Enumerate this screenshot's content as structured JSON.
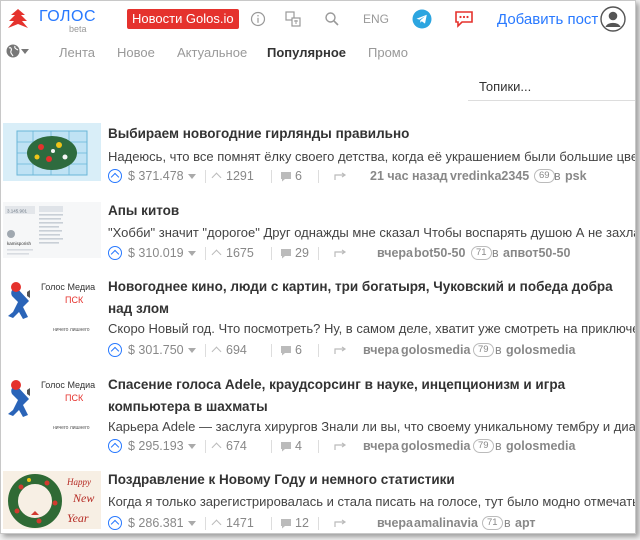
{
  "header": {
    "brand": "ГОЛОС",
    "beta": "beta",
    "news_button": "Новости Golos.io",
    "lang": "ENG",
    "add_post": "Добавить пост"
  },
  "nav": {
    "tabs": [
      {
        "label": "Лента",
        "active": false
      },
      {
        "label": "Новое",
        "active": false
      },
      {
        "label": "Актуальное",
        "active": false
      },
      {
        "label": "Популярное",
        "active": true
      },
      {
        "label": "Промо",
        "active": false
      }
    ],
    "topics_placeholder": "Топики..."
  },
  "posts": [
    {
      "title": "Выбираем новогодние гирлянды правильно",
      "excerpt": "Надеюсь, что все помнят ёлку своего детства, когда её украшением были большие цветные",
      "payout": "$ 371.478",
      "votes": "1291",
      "comments": "6",
      "time": "21 час назад",
      "author": "vredinka2345",
      "reputation": "69",
      "in": "в",
      "category": "psk"
    },
    {
      "title": "Апы китов",
      "excerpt": "\"Хобби\" значит \"дорогое\" Друг однажды мне сказал Чтобы воспарять душою А не захламля",
      "payout": "$ 310.019",
      "votes": "1675",
      "comments": "29",
      "time": "вчера",
      "author": "bot50-50",
      "reputation": "71",
      "in": "в",
      "category": "апвот50-50"
    },
    {
      "title": "Новогоднее кино, люди с картин, три богатыря, Чуковский и победа добра над злом",
      "excerpt": "Скоро Новый год. Что посмотреть? Ну, в самом деле, хватит уже смотреть на приключения",
      "payout": "$ 301.750",
      "votes": "694",
      "comments": "6",
      "time": "вчера",
      "author": "golosmedia",
      "reputation": "79",
      "in": "в",
      "category": "golosmedia"
    },
    {
      "title": "Спасение голоса Adele, краудсорсинг в науке, инцепционизм и игра компьютера в шахматы",
      "excerpt": "Карьера Adele — заслуга хирургов Знали ли вы, что своему уникальному тембру и диапазо",
      "payout": "$ 295.193",
      "votes": "674",
      "comments": "4",
      "time": "вчера",
      "author": "golosmedia",
      "reputation": "79",
      "in": "в",
      "category": "golosmedia"
    },
    {
      "title": "Поздравление к Новому Году и немного статистики",
      "excerpt": "Когда я только зарегистрировалась и стала писать на голосе, тут было модно отмечать каж",
      "payout": "$ 286.381",
      "votes": "1471",
      "comments": "12",
      "time": "вчера",
      "author": "amalinavia",
      "reputation": "71",
      "in": "в",
      "category": "арт"
    }
  ],
  "thumb_text": {
    "golosmedia_line1": "Голос Медиа",
    "golosmedia_line2": "ПСК",
    "golosmedia_line3": "ничего лишнего",
    "newyear_line1": "Happy",
    "newyear_line2": "New",
    "newyear_line3": "Year",
    "whales_balance": "3.145.901",
    "whales_user": "kamisporish"
  },
  "colors": {
    "accent": "#2879ff",
    "news_red": "#e5322d",
    "telegram": "#2ca5e0",
    "chat_red": "#e5322d"
  },
  "icons": [
    "logo-icon",
    "info-icon",
    "translate-icon",
    "search-icon",
    "telegram-icon",
    "chat-icon",
    "user-icon",
    "globe-icon",
    "upvote-icon",
    "comments-icon",
    "repost-icon"
  ]
}
